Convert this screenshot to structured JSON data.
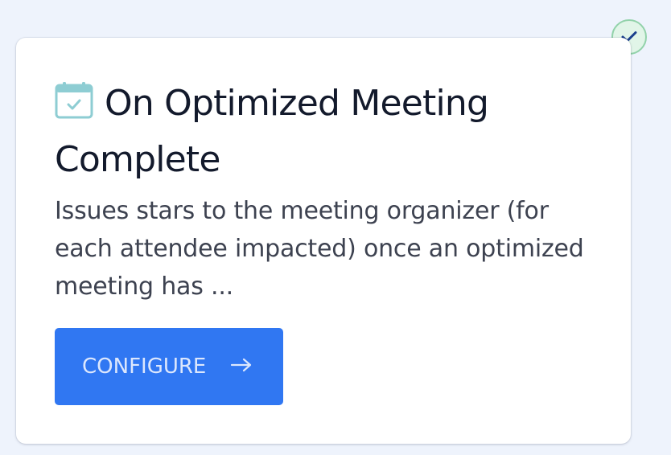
{
  "card": {
    "title": "On Optimized Meeting Complete",
    "description": "Issues stars to the meeting organizer (for each attendee impacted) once an optimized meeting has ...",
    "button_label": "CONFIGURE",
    "icons": {
      "title_icon": "calendar-check-icon",
      "button_icon": "arrow-right-icon",
      "status_icon": "checkmark-icon"
    }
  },
  "colors": {
    "page_background": "#eef3fc",
    "card_background": "#ffffff",
    "title_text": "#131a2c",
    "description_text": "#3d4250",
    "button_background": "#3077f2",
    "button_text": "#dce7fd",
    "calendar_icon": "#8ecdd3",
    "status_badge_background": "#e1f5e8",
    "status_badge_border": "#92d2aa",
    "status_checkmark": "#1a3f8c"
  }
}
